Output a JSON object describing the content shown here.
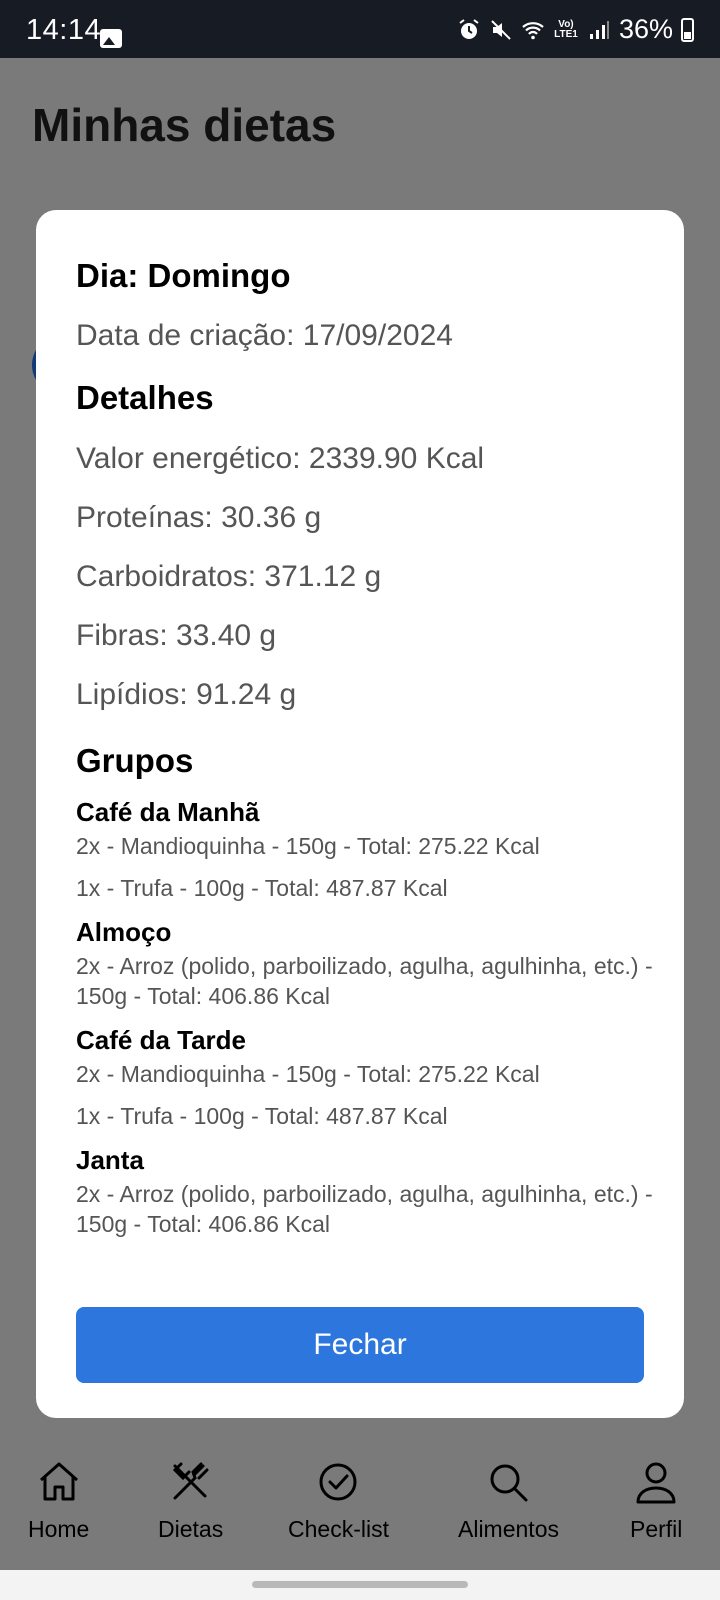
{
  "status_bar": {
    "time": "14:14",
    "lte_label": "Vo) LTE1",
    "battery": "36%"
  },
  "page": {
    "title": "Minhas dietas"
  },
  "modal": {
    "day_title": "Dia: Domingo",
    "created": "Data de criação: 17/09/2024",
    "details_heading": "Detalhes",
    "details": [
      "Valor energético: 2339.90 Kcal",
      "Proteínas: 30.36 g",
      "Carboidratos: 371.12 g",
      "Fibras: 33.40 g",
      "Lipídios: 91.24 g"
    ],
    "groups_heading": "Grupos",
    "groups": [
      {
        "name": "Café da Manhã",
        "items": [
          "2x - Mandioquinha - 150g - Total: 275.22 Kcal",
          "1x - Trufa  - 100g - Total: 487.87 Kcal"
        ]
      },
      {
        "name": "Almoço",
        "items": [
          "2x - Arroz (polido, parboilizado, agulha, agulhinha, etc.) - 150g - Total: 406.86 Kcal"
        ]
      },
      {
        "name": "Café da Tarde",
        "items": [
          "2x - Mandioquinha - 150g - Total: 275.22 Kcal",
          "1x - Trufa  - 100g - Total: 487.87 Kcal"
        ]
      },
      {
        "name": "Janta",
        "items": [
          "2x - Arroz (polido, parboilizado, agulha, agulhinha, etc.) - 150g - Total: 406.86 Kcal"
        ]
      }
    ],
    "close_label": "Fechar"
  },
  "nav": {
    "items": [
      {
        "label": "Home",
        "icon": "home-icon"
      },
      {
        "label": "Dietas",
        "icon": "utensils-icon"
      },
      {
        "label": "Check-list",
        "icon": "check-circle-icon"
      },
      {
        "label": "Alimentos",
        "icon": "search-icon"
      },
      {
        "label": "Perfil",
        "icon": "user-icon"
      }
    ]
  },
  "colors": {
    "primary_button": "#2c76de",
    "status_bar": "#171b24",
    "scrim": "#7a7a7a"
  }
}
